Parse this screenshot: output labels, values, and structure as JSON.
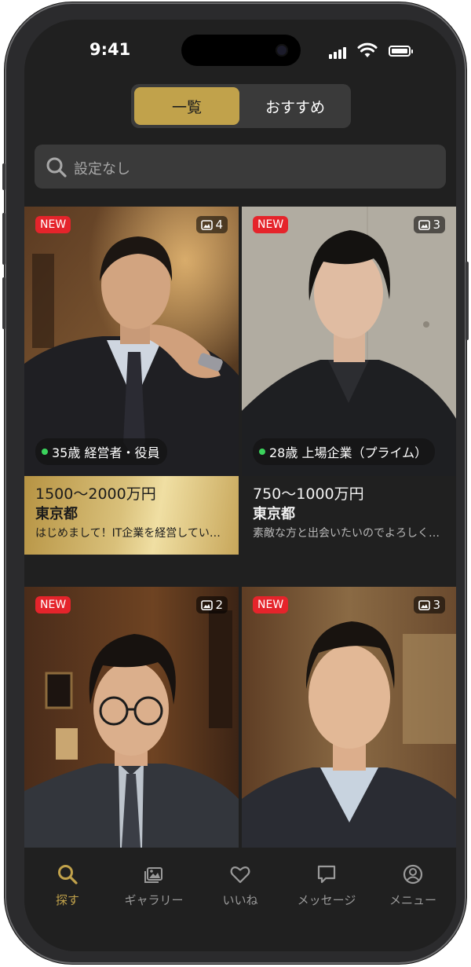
{
  "status_bar": {
    "time": "9:41"
  },
  "segmented": {
    "tabs": [
      {
        "label": "一覧",
        "active": true
      },
      {
        "label": "おすすめ",
        "active": false
      }
    ]
  },
  "search": {
    "placeholder": "設定なし"
  },
  "profiles": [
    {
      "badge": "NEW",
      "photo_count": "4",
      "age_job": "35歳 経営者・役員",
      "income": "1500〜2000万円",
      "prefecture": "東京都",
      "message": "はじめまして！IT企業を経営しています",
      "highlight": true
    },
    {
      "badge": "NEW",
      "photo_count": "3",
      "age_job": "28歳 上場企業（プライム）",
      "income": "750〜1000万円",
      "prefecture": "東京都",
      "message": "素敵な方と出会いたいのでよろしくお願いします",
      "highlight": false
    },
    {
      "badge": "NEW",
      "photo_count": "2"
    },
    {
      "badge": "NEW",
      "photo_count": "3"
    }
  ],
  "tab_bar": {
    "items": [
      {
        "label": "探す",
        "icon": "search-icon",
        "active": true
      },
      {
        "label": "ギャラリー",
        "icon": "gallery-icon",
        "active": false
      },
      {
        "label": "いいね",
        "icon": "heart-icon",
        "active": false
      },
      {
        "label": "メッセージ",
        "icon": "message-icon",
        "active": false
      },
      {
        "label": "メニュー",
        "icon": "profile-icon",
        "active": false
      }
    ]
  },
  "colors": {
    "accent": "#c1a24b",
    "badge": "#e5242b",
    "online": "#3bd35c",
    "background": "#202020"
  }
}
